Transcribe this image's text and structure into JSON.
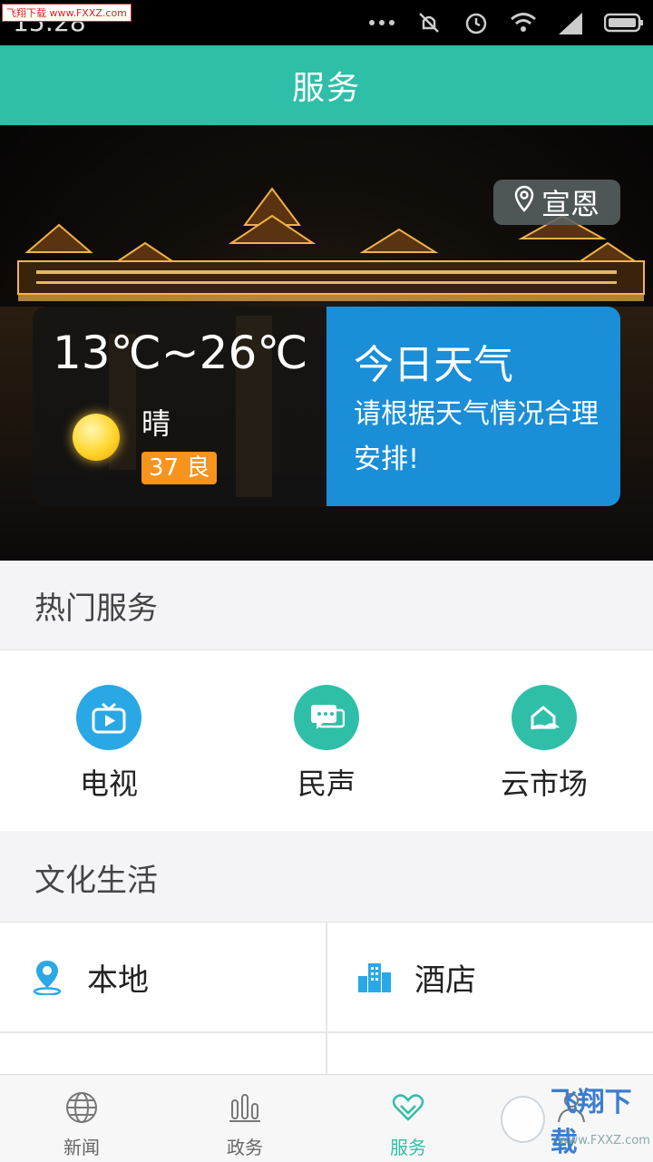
{
  "status_bar": {
    "time": "15:28",
    "watermark": "飞翔下载 www.FXXZ.com"
  },
  "app_bar": {
    "title": "服务"
  },
  "hero": {
    "location": "宣恩",
    "weather": {
      "temp_range": "13℃~26℃",
      "condition": "晴",
      "aqi": "37 良",
      "today_title": "今日天气",
      "today_desc": "请根据天气情况合理安排!"
    }
  },
  "hot_services": {
    "title": "热门服务",
    "items": [
      {
        "label": "电视",
        "icon": "tv-icon",
        "color": "#2aa8e6"
      },
      {
        "label": "民声",
        "icon": "chat-icon",
        "color": "#2fbfa9"
      },
      {
        "label": "云市场",
        "icon": "cloud-market-icon",
        "color": "#2fbfa9"
      }
    ]
  },
  "culture": {
    "title": "文化生活",
    "items": [
      {
        "label": "本地",
        "icon": "location-pin-icon"
      },
      {
        "label": "酒店",
        "icon": "buildings-icon"
      }
    ]
  },
  "bottom_nav": {
    "items": [
      {
        "label": "新闻",
        "icon": "globe-icon"
      },
      {
        "label": "政务",
        "icon": "columns-icon"
      },
      {
        "label": "服务",
        "icon": "heart-icon",
        "active": true
      },
      {
        "label": "",
        "icon": "user-icon"
      }
    ]
  },
  "watermark_bottom": {
    "text": "飞翔下载",
    "url": "www.FXXZ.com"
  },
  "colors": {
    "accent": "#2fbfa9",
    "weather_blue": "#1a8fd8",
    "aqi_orange": "#f7941d"
  }
}
